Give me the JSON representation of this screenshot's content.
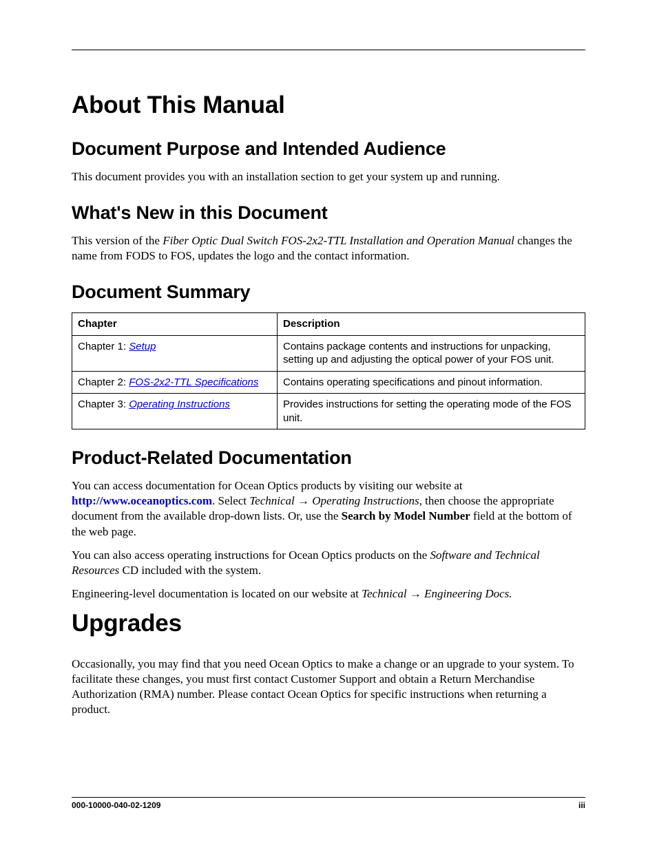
{
  "title_about": "About This Manual",
  "h2_purpose": "Document Purpose and Intended Audience",
  "p_purpose": "This document provides you with an installation section to get your system up and running.",
  "h2_whatsnew": "What's New in this Document",
  "p_whatsnew_pre": "This version of the ",
  "p_whatsnew_ital": "Fiber Optic Dual Switch FOS-2x2-TTL  Installation and Operation Manual",
  "p_whatsnew_post": " changes the name from FODS to FOS, updates the logo and the contact information.",
  "h2_summary": "Document Summary",
  "table": {
    "head_chapter": "Chapter",
    "head_desc": "Description",
    "rows": [
      {
        "prefix": "Chapter 1: ",
        "link": "Setup",
        "desc": "Contains package contents and instructions for unpacking, setting up and adjusting the optical power of your FOS unit."
      },
      {
        "prefix": "Chapter 2: ",
        "link": "FOS-2x2-TTL Specifications",
        "desc": "Contains operating specifications and pinout information."
      },
      {
        "prefix": "Chapter 3: ",
        "link": "Operating Instructions",
        "desc": "Provides instructions for setting the operating mode of the FOS unit."
      }
    ]
  },
  "h2_related": "Product-Related Documentation",
  "related_p1_a": "You can access documentation for Ocean Optics products by visiting our website at ",
  "related_url": "http://www.oceanoptics.com",
  "related_p1_b": ". Select ",
  "related_p1_nav1": "Technical → Operating Instructions",
  "related_p1_c": ", then choose the appropriate document from the available drop-down lists. Or, use the ",
  "related_p1_bold": "Search by Model Number",
  "related_p1_d": " field at the bottom of the web page.",
  "related_p2_a": "You can also access operating instructions for Ocean Optics products on the ",
  "related_p2_ital": "Software and Technical Resources",
  "related_p2_b": " CD included with the system.",
  "related_p3_a": "Engineering-level documentation is located on our website at ",
  "related_p3_ital": "Technical → Engineering Docs.",
  "title_upgrades": "Upgrades",
  "p_upgrades": "Occasionally, you may find that you need Ocean Optics to make a change or an upgrade to your system. To facilitate these changes, you must first contact Customer Support and obtain a Return Merchandise Authorization (RMA) number. Please contact Ocean Optics for specific instructions when returning a product.",
  "footer_left": "000-10000-040-02-1209",
  "footer_right": "iii"
}
